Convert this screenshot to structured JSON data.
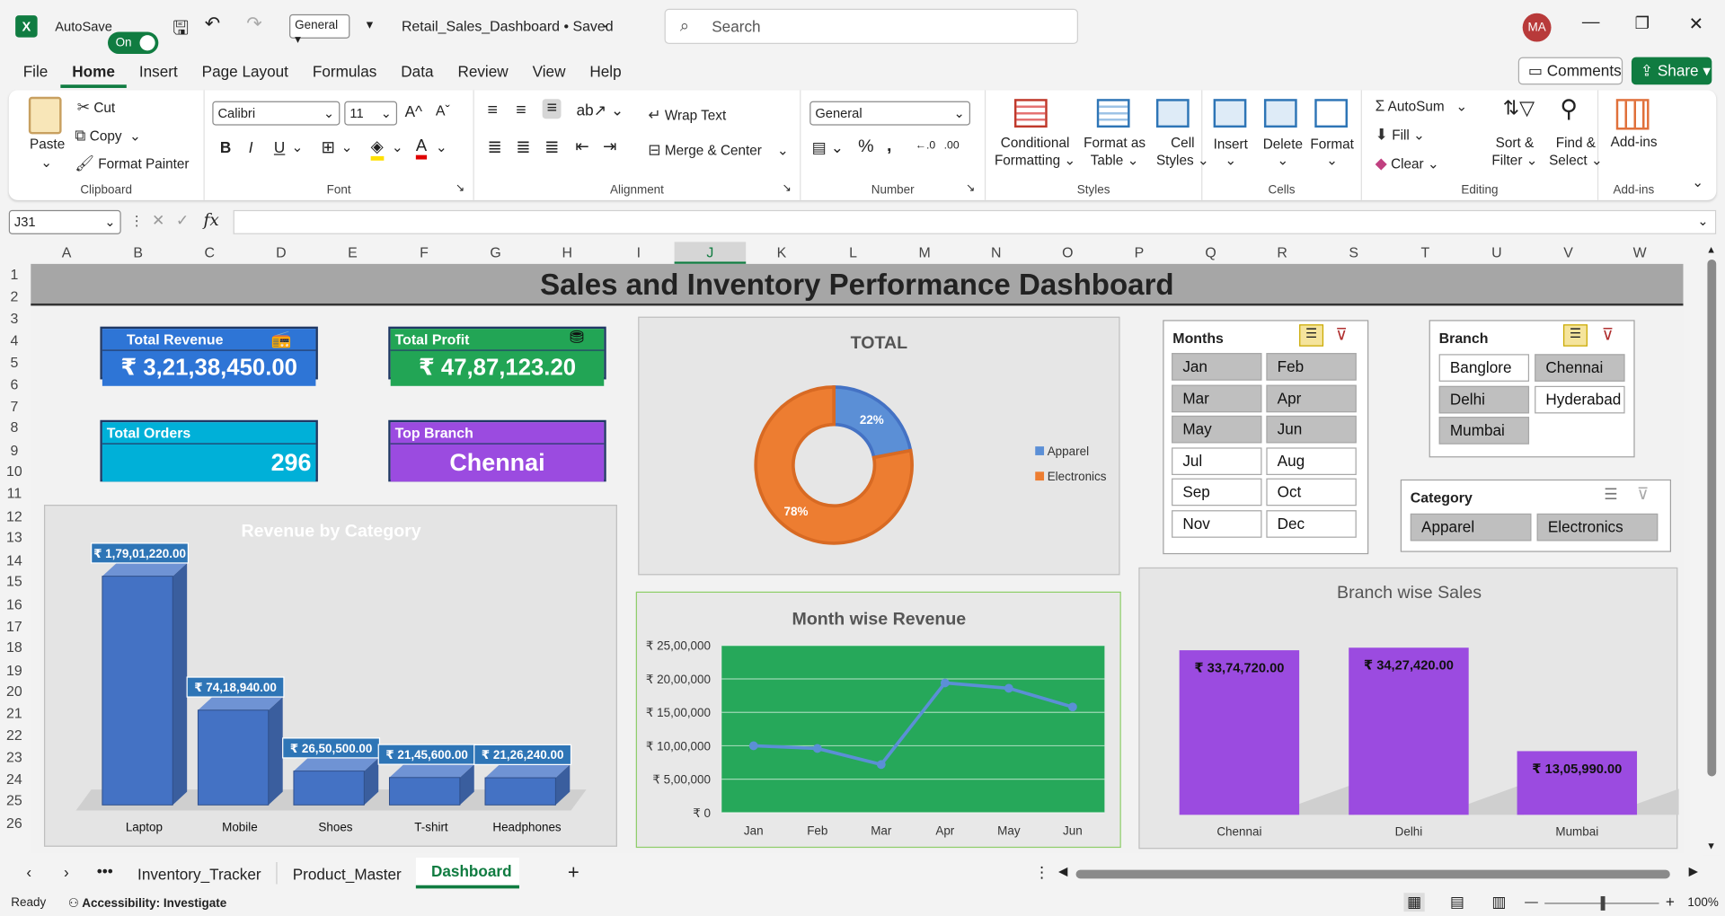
{
  "titlebar": {
    "autosave": "AutoSave",
    "toggle": "On",
    "numfmt": "General",
    "filename": "Retail_Sales_Dashboard • Saved",
    "search": "Search",
    "user": "MA"
  },
  "menu": [
    "File",
    "Home",
    "Insert",
    "Page Layout",
    "Formulas",
    "Data",
    "Review",
    "View",
    "Help"
  ],
  "comments": "Comments",
  "share": "Share",
  "ribbon": {
    "clipboard": {
      "paste": "Paste",
      "cut": "Cut",
      "copy": "Copy",
      "painter": "Format Painter",
      "label": "Clipboard"
    },
    "font": {
      "name": "Calibri",
      "size": "11",
      "label": "Font"
    },
    "alignment": {
      "wrap": "Wrap Text",
      "merge": "Merge & Center",
      "label": "Alignment"
    },
    "number": {
      "format": "General",
      "label": "Number"
    },
    "styles": {
      "cond1": "Conditional",
      "cond2": "Formatting",
      "fmt1": "Format as",
      "fmt2": "Table",
      "cell1": "Cell",
      "cell2": "Styles",
      "label": "Styles"
    },
    "cells": {
      "insert": "Insert",
      "delete": "Delete",
      "format": "Format",
      "label": "Cells"
    },
    "editing": {
      "autosum": "AutoSum",
      "fill": "Fill",
      "clear": "Clear",
      "sort1": "Sort &",
      "sort2": "Filter",
      "find1": "Find &",
      "find2": "Select",
      "label": "Editing"
    },
    "addins": {
      "btn": "Add-ins",
      "label": "Add-ins"
    }
  },
  "namebox": "J31",
  "columns": [
    "A",
    "B",
    "C",
    "D",
    "E",
    "F",
    "G",
    "H",
    "I",
    "J",
    "K",
    "L",
    "M",
    "N",
    "O",
    "P",
    "Q",
    "R",
    "S",
    "T",
    "U",
    "V",
    "W"
  ],
  "rows": [
    "1",
    "2",
    "3",
    "4",
    "5",
    "6",
    "7",
    "8",
    "9",
    "10",
    "11",
    "12",
    "13",
    "14",
    "15",
    "16",
    "17",
    "18",
    "19",
    "20",
    "21",
    "22",
    "23",
    "24",
    "25",
    "26"
  ],
  "dashboard": {
    "title": "Sales and Inventory Performance Dashboard",
    "kpis": {
      "revenue": {
        "label": "Total Revenue",
        "value": "₹ 3,21,38,450.00",
        "color": "#2e75d6"
      },
      "profit": {
        "label": "Total Profit",
        "value": "₹ 47,87,123.20",
        "color": "#22a555"
      },
      "orders": {
        "label": "Total Orders",
        "value": "296",
        "color": "#00b0d8"
      },
      "branch": {
        "label": "Top Branch",
        "value": "Chennai",
        "color": "#9b4be0"
      }
    }
  },
  "slicers": {
    "months": {
      "title": "Months",
      "items": [
        {
          "label": "Jan",
          "on": true
        },
        {
          "label": "Feb",
          "on": true
        },
        {
          "label": "Mar",
          "on": true
        },
        {
          "label": "Apr",
          "on": true
        },
        {
          "label": "May",
          "on": true
        },
        {
          "label": "Jun",
          "on": true
        },
        {
          "label": "Jul",
          "on": false
        },
        {
          "label": "Aug",
          "on": false
        },
        {
          "label": "Sep",
          "on": false
        },
        {
          "label": "Oct",
          "on": false
        },
        {
          "label": "Nov",
          "on": false
        },
        {
          "label": "Dec",
          "on": false
        }
      ]
    },
    "branch": {
      "title": "Branch",
      "items": [
        {
          "label": "Banglore",
          "on": false
        },
        {
          "label": "Chennai",
          "on": true
        },
        {
          "label": "Delhi",
          "on": true
        },
        {
          "label": "Hyderabad",
          "on": false
        },
        {
          "label": "Mumbai",
          "on": true
        }
      ]
    },
    "category": {
      "title": "Category",
      "items": [
        {
          "label": "Apparel",
          "on": true
        },
        {
          "label": "Electronics",
          "on": true
        }
      ]
    }
  },
  "chart_data": [
    {
      "type": "bar",
      "title": "Revenue by Category",
      "categories": [
        "Laptop",
        "Mobile",
        "Shoes",
        "T-shirt",
        "Headphones"
      ],
      "values": [
        17901220,
        7418940,
        2650500,
        2145600,
        2126240
      ],
      "labels": [
        "₹ 1,79,01,220.00",
        "₹ 74,18,940.00",
        "₹ 26,50,500.00",
        "₹ 21,45,600.00",
        "₹ 21,26,240.00"
      ],
      "color": "#4472c4"
    },
    {
      "type": "pie",
      "title": "TOTAL",
      "categories": [
        "Apparel",
        "Electronics"
      ],
      "values": [
        22,
        78
      ],
      "labels": [
        "22%",
        "78%"
      ],
      "colors": [
        "#5b8fd6",
        "#ed7d31"
      ],
      "legend": "right"
    },
    {
      "type": "line",
      "title": "Month wise Revenue",
      "categories": [
        "Jan",
        "Feb",
        "Mar",
        "Apr",
        "May",
        "Jun"
      ],
      "values": [
        1000000,
        960000,
        720000,
        1940000,
        1860000,
        1580000
      ],
      "yticks": [
        "₹ 0",
        "₹ 5,00,000",
        "₹ 10,00,000",
        "₹ 15,00,000",
        "₹ 20,00,000",
        "₹ 25,00,000"
      ],
      "ylim": [
        0,
        2500000
      ],
      "color": "#5b8fd6",
      "plot_bg": "#26a85a"
    },
    {
      "type": "bar",
      "title": "Branch wise Sales",
      "categories": [
        "Chennai",
        "Delhi",
        "Mumbai"
      ],
      "values": [
        3374720,
        3427420,
        1305990
      ],
      "labels": [
        "₹ 33,74,720.00",
        "₹ 34,27,420.00",
        "₹ 13,05,990.00"
      ],
      "color": "#9b4be0"
    }
  ],
  "tabs": {
    "t1": "Inventory_Tracker",
    "t2": "Product_Master",
    "t3": "Dashboard"
  },
  "status": {
    "ready": "Ready",
    "access": "Accessibility: Investigate",
    "zoom": "100%"
  }
}
